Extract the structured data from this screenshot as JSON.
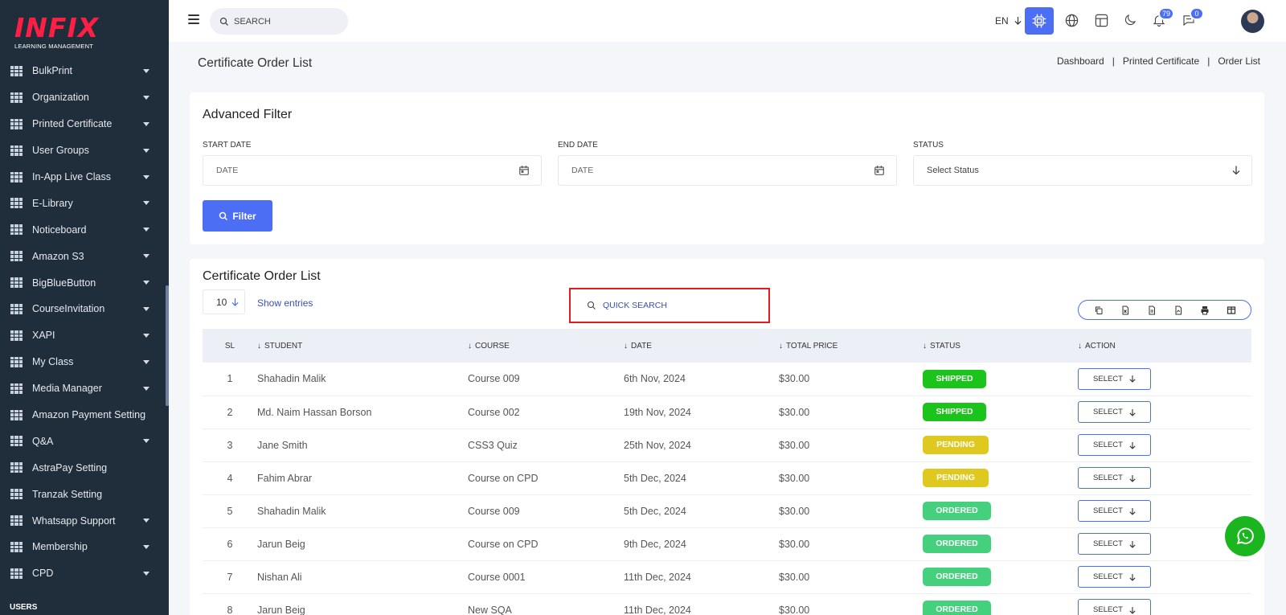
{
  "brand": {
    "name": "INFIX",
    "subtitle": "LEARNING MANAGEMENT"
  },
  "sidebar": {
    "items": [
      {
        "label": "BulkPrint",
        "has_caret": true
      },
      {
        "label": "Organization",
        "has_caret": true
      },
      {
        "label": "Printed Certificate",
        "has_caret": true
      },
      {
        "label": "User Groups",
        "has_caret": true
      },
      {
        "label": "In-App Live Class",
        "has_caret": true
      },
      {
        "label": "E-Library",
        "has_caret": true
      },
      {
        "label": "Noticeboard",
        "has_caret": true
      },
      {
        "label": "Amazon S3",
        "has_caret": true
      },
      {
        "label": "BigBlueButton",
        "has_caret": true
      },
      {
        "label": "CourseInvitation",
        "has_caret": true
      },
      {
        "label": "XAPI",
        "has_caret": true
      },
      {
        "label": "My Class",
        "has_caret": true
      },
      {
        "label": "Media Manager",
        "has_caret": true
      },
      {
        "label": "Amazon Payment Setting",
        "has_caret": false
      },
      {
        "label": "Q&A",
        "has_caret": true
      },
      {
        "label": "AstraPay Setting",
        "has_caret": false
      },
      {
        "label": "Tranzak Setting",
        "has_caret": false
      },
      {
        "label": "Whatsapp Support",
        "has_caret": true
      },
      {
        "label": "Membership",
        "has_caret": true
      },
      {
        "label": "CPD",
        "has_caret": true
      }
    ],
    "section_label": "USERS"
  },
  "header": {
    "search_placeholder": "SEARCH",
    "language": "EN",
    "notifications_count": "79",
    "messages_count": "0"
  },
  "page": {
    "title": "Certificate Order List",
    "breadcrumb": [
      "Dashboard",
      "Printed Certificate",
      "Order List"
    ]
  },
  "filter": {
    "title": "Advanced Filter",
    "start_date_label": "START DATE",
    "start_date_placeholder": "DATE",
    "end_date_label": "END DATE",
    "end_date_placeholder": "DATE",
    "status_label": "STATUS",
    "status_value": "Select Status",
    "button_label": "Filter"
  },
  "list": {
    "title": "Certificate Order List",
    "entries": "10",
    "show_entries": "Show entries",
    "quick_search_placeholder": "QUICK SEARCH",
    "columns": [
      "SL",
      "STUDENT",
      "COURSE",
      "DATE",
      "TOTAL PRICE",
      "STATUS",
      "ACTION"
    ],
    "select_label": "SELECT",
    "rows": [
      {
        "sl": "1",
        "student": "Shahadin Malik",
        "course": "Course 009",
        "date": "6th Nov, 2024",
        "price": "$30.00",
        "status": "SHIPPED"
      },
      {
        "sl": "2",
        "student": "Md. Naim Hassan Borson",
        "course": "Course 002",
        "date": "19th Nov, 2024",
        "price": "$30.00",
        "status": "SHIPPED"
      },
      {
        "sl": "3",
        "student": "Jane Smith",
        "course": "CSS3 Quiz",
        "date": "25th Nov, 2024",
        "price": "$30.00",
        "status": "PENDING"
      },
      {
        "sl": "4",
        "student": "Fahim Abrar",
        "course": "Course on CPD",
        "date": "5th Dec, 2024",
        "price": "$30.00",
        "status": "PENDING"
      },
      {
        "sl": "5",
        "student": "Shahadin Malik",
        "course": "Course 009",
        "date": "5th Dec, 2024",
        "price": "$30.00",
        "status": "ORDERED"
      },
      {
        "sl": "6",
        "student": "Jarun Beig",
        "course": "Course on CPD",
        "date": "9th Dec, 2024",
        "price": "$30.00",
        "status": "ORDERED"
      },
      {
        "sl": "7",
        "student": "Nishan Ali",
        "course": "Course 0001",
        "date": "11th Dec, 2024",
        "price": "$30.00",
        "status": "ORDERED"
      },
      {
        "sl": "8",
        "student": "Jarun Beig",
        "course": "New SQA",
        "date": "11th Dec, 2024",
        "price": "$30.00",
        "status": "ORDERED"
      }
    ]
  },
  "colors": {
    "accent": "#4c6ef5",
    "sidebar_bg": "#202e3b",
    "shipped": "#1bc41b",
    "pending": "#e0c91f",
    "ordered": "#44d07d",
    "highlight_box": "#e21b1b",
    "whatsapp": "#1bb51f"
  }
}
